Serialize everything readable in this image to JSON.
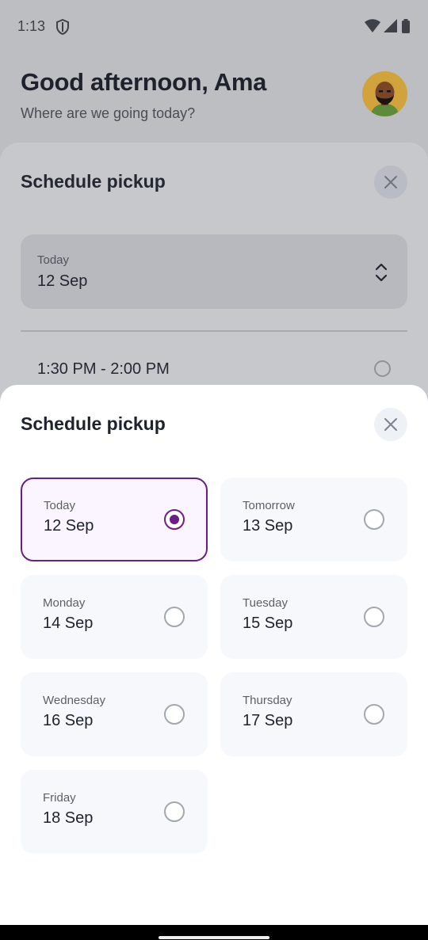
{
  "status_bar": {
    "time": "1:13"
  },
  "header": {
    "greeting": "Good afternoon, Ama",
    "subtitle": "Where are we going today?"
  },
  "background_sheet": {
    "title": "Schedule pickup",
    "selected_day": "Today",
    "selected_date": "12 Sep",
    "time_slot": "1:30 PM - 2:00 PM"
  },
  "sheet": {
    "title": "Schedule pickup",
    "dates": [
      {
        "day": "Today",
        "date": "12 Sep",
        "selected": true
      },
      {
        "day": "Tomorrow",
        "date": "13 Sep",
        "selected": false
      },
      {
        "day": "Monday",
        "date": "14 Sep",
        "selected": false
      },
      {
        "day": "Tuesday",
        "date": "15 Sep",
        "selected": false
      },
      {
        "day": "Wednesday",
        "date": "16 Sep",
        "selected": false
      },
      {
        "day": "Thursday",
        "date": "17 Sep",
        "selected": false
      },
      {
        "day": "Friday",
        "date": "18 Sep",
        "selected": false
      }
    ]
  },
  "colors": {
    "accent": "#6a1f87",
    "selected_bg": "#fbf5ff",
    "card_bg": "#f6f8fb",
    "scrim": "#bdbec2"
  },
  "icons": [
    "shield-icon",
    "wifi-icon",
    "signal-icon",
    "battery-icon",
    "close-icon",
    "chevron-up-down-icon",
    "radio-icon"
  ]
}
